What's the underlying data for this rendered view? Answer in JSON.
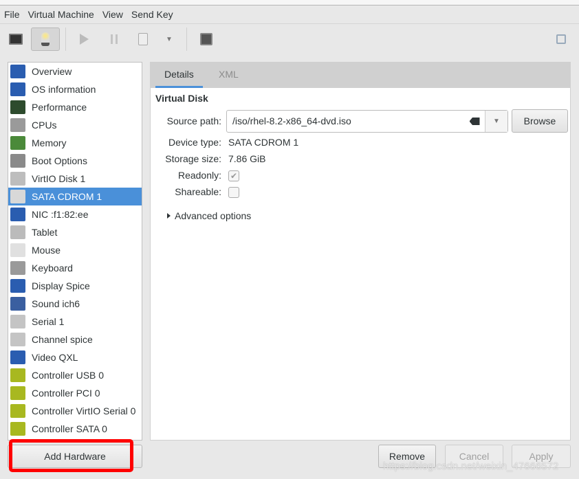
{
  "menubar": {
    "items": [
      "File",
      "Virtual Machine",
      "View",
      "Send Key"
    ]
  },
  "toolbar": {
    "buttons": [
      "console-icon",
      "details-lightbulb-icon",
      "run-icon",
      "pause-icon",
      "shutdown-icon",
      "shutdown-menu-icon",
      "snapshots-icon",
      "fullscreen-icon"
    ],
    "active": "details-lightbulb-icon"
  },
  "sidebar": {
    "selected": "SATA CDROM 1",
    "items": [
      {
        "label": "Overview",
        "icon": "monitor-icon",
        "color": "#2a5db0"
      },
      {
        "label": "OS information",
        "icon": "monitor-icon",
        "color": "#2a5db0"
      },
      {
        "label": "Performance",
        "icon": "performance-graph-icon",
        "color": "#2d4b2d"
      },
      {
        "label": "CPUs",
        "icon": "cpu-chip-icon",
        "color": "#9a9a9a"
      },
      {
        "label": "Memory",
        "icon": "memory-module-icon",
        "color": "#4b8a3a"
      },
      {
        "label": "Boot Options",
        "icon": "gears-icon",
        "color": "#8a8a8a"
      },
      {
        "label": "VirtIO Disk 1",
        "icon": "hard-disk-icon",
        "color": "#bdbdbd"
      },
      {
        "label": "SATA CDROM 1",
        "icon": "cdrom-icon",
        "color": "#d8d8d8"
      },
      {
        "label": "NIC :f1:82:ee",
        "icon": "network-icon",
        "color": "#2a5db0"
      },
      {
        "label": "Tablet",
        "icon": "tablet-icon",
        "color": "#bbbbbb"
      },
      {
        "label": "Mouse",
        "icon": "mouse-icon",
        "color": "#e0e0e0"
      },
      {
        "label": "Keyboard",
        "icon": "keyboard-icon",
        "color": "#9a9a9a"
      },
      {
        "label": "Display Spice",
        "icon": "monitor-icon",
        "color": "#2a5db0"
      },
      {
        "label": "Sound ich6",
        "icon": "sound-card-icon",
        "color": "#3a5fa0"
      },
      {
        "label": "Serial 1",
        "icon": "serial-port-icon",
        "color": "#c4c4c4"
      },
      {
        "label": "Channel spice",
        "icon": "channel-icon",
        "color": "#c4c4c4"
      },
      {
        "label": "Video QXL",
        "icon": "monitor-icon",
        "color": "#2a5db0"
      },
      {
        "label": "Controller USB 0",
        "icon": "controller-card-icon",
        "color": "#a8b820"
      },
      {
        "label": "Controller PCI 0",
        "icon": "controller-card-icon",
        "color": "#a8b820"
      },
      {
        "label": "Controller VirtIO Serial 0",
        "icon": "controller-card-icon",
        "color": "#a8b820"
      },
      {
        "label": "Controller SATA 0",
        "icon": "controller-card-icon",
        "color": "#a8b820"
      }
    ]
  },
  "add_hardware_label": "Add Hardware",
  "tabs": [
    "Details",
    "XML"
  ],
  "details": {
    "section": "Virtual Disk",
    "source_path_label": "Source path:",
    "source_path": "/iso/rhel-8.2-x86_64-dvd.iso",
    "browse_label": "Browse",
    "device_type_label": "Device type:",
    "device_type": "SATA CDROM 1",
    "storage_size_label": "Storage size:",
    "storage_size": "7.86 GiB",
    "readonly_label": "Readonly:",
    "readonly": true,
    "shareable_label": "Shareable:",
    "shareable": false,
    "advanced_label": "Advanced options"
  },
  "footer": {
    "remove": "Remove",
    "cancel": "Cancel",
    "apply": "Apply"
  },
  "watermark": "https://blog.csdn.net/weixin_47666572",
  "colors": {
    "accent": "#4a90d9",
    "highlight": "#ff0000"
  }
}
